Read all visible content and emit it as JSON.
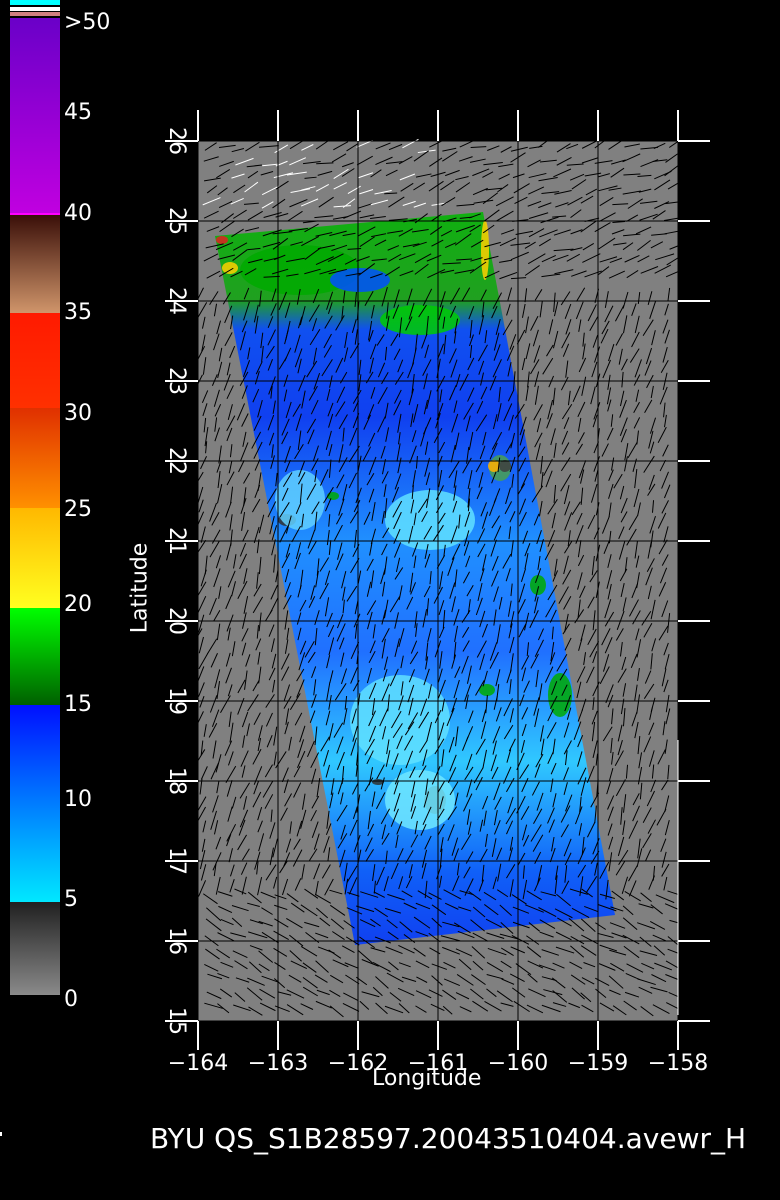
{
  "colorbar": {
    "labels": [
      ">50",
      "45",
      "40",
      "35",
      "30",
      "25",
      "20",
      "15",
      "10",
      "5",
      "0"
    ],
    "colors": {
      "purple": "#6a00c8",
      "magenta": "#ff00ff",
      "brown": "#5a1f10",
      "tan": "#c07850",
      "red": "#ff1a00",
      "orange": "#ff7a00",
      "yellow": "#ffd000",
      "green": "#00d000",
      "blue": "#0030ff",
      "cyan": "#00ffff",
      "gray": "#808080"
    }
  },
  "axes": {
    "xlabel": "Longitude",
    "ylabel": "Latitude",
    "xticks": [
      "−164",
      "−163",
      "−162",
      "−161",
      "−160",
      "−159",
      "−158"
    ],
    "yticks": [
      "15",
      "16",
      "17",
      "18",
      "19",
      "20",
      "21",
      "22",
      "23",
      "24",
      "25",
      "26"
    ],
    "xrange": [
      -164,
      -158
    ],
    "yrange": [
      15,
      26
    ]
  },
  "footer": {
    "text": "BYU  QS_S1B28597.20043510404.avewr_H"
  }
}
